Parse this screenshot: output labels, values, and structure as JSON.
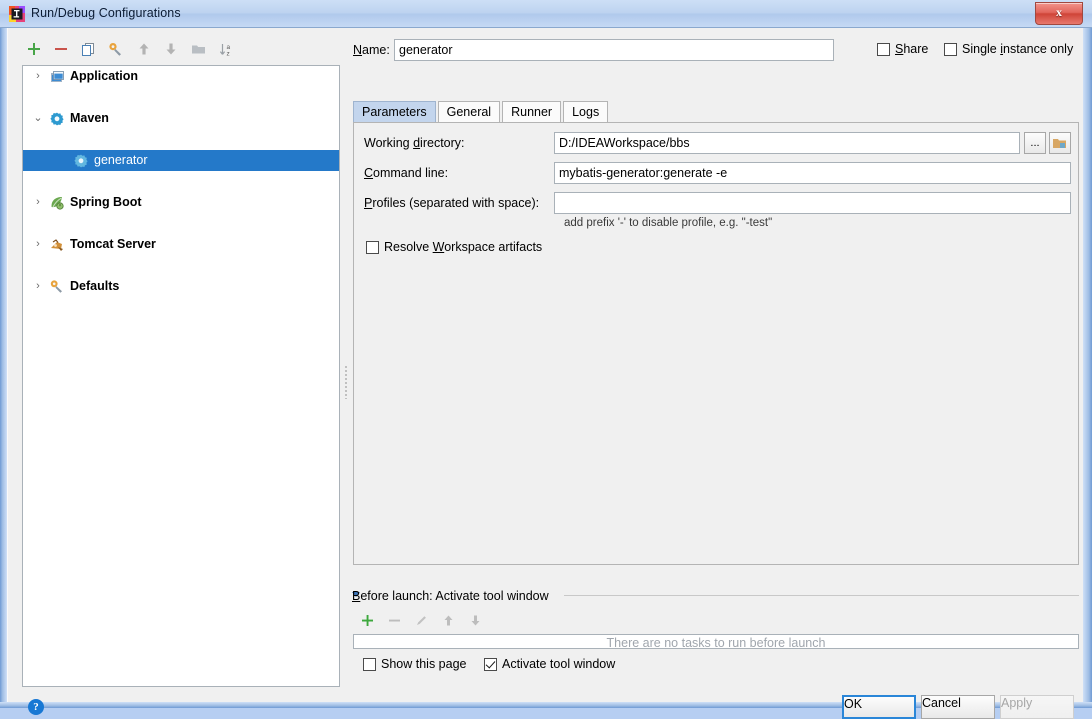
{
  "window": {
    "title": "Run/Debug Configurations",
    "app_icon": "intellij-idea-icon",
    "close_label": "x"
  },
  "toolbar": {
    "buttons": [
      {
        "name": "add-configuration-button",
        "icon": "plus-icon"
      },
      {
        "name": "remove-configuration-button",
        "icon": "minus-icon"
      },
      {
        "name": "copy-configuration-button",
        "icon": "copy-icon"
      },
      {
        "name": "edit-templates-button",
        "icon": "wrench-icon"
      },
      {
        "name": "move-up-button",
        "icon": "arrow-up-icon"
      },
      {
        "name": "move-down-button",
        "icon": "arrow-down-icon"
      },
      {
        "name": "create-folder-button",
        "icon": "folder-icon"
      },
      {
        "name": "sort-configurations-button",
        "icon": "sort-az-icon"
      }
    ]
  },
  "tree": {
    "nodes": [
      {
        "label": "Application",
        "icon": "application-icon",
        "arrow": "›",
        "expanded": false,
        "selected": false,
        "child": false
      },
      {
        "label": "Maven",
        "icon": "maven-icon",
        "arrow": "⌄",
        "expanded": true,
        "selected": false,
        "child": false
      },
      {
        "label": "generator",
        "icon": "maven-icon",
        "arrow": "",
        "expanded": false,
        "selected": true,
        "child": true
      },
      {
        "label": "Spring Boot",
        "icon": "spring-boot-icon",
        "arrow": "›",
        "expanded": false,
        "selected": false,
        "child": false
      },
      {
        "label": "Tomcat Server",
        "icon": "tomcat-icon",
        "arrow": "›",
        "expanded": false,
        "selected": false,
        "child": false
      },
      {
        "label": "Defaults",
        "icon": "defaults-icon",
        "arrow": "›",
        "expanded": false,
        "selected": false,
        "child": false
      }
    ]
  },
  "form": {
    "name_label": "Name:",
    "name_value": "generator",
    "share_label": "Share",
    "share_checked": false,
    "single_instance_label": "Single instance only",
    "single_instance_checked": false
  },
  "tabs": [
    {
      "label": "Parameters",
      "active": true
    },
    {
      "label": "General",
      "active": false
    },
    {
      "label": "Runner",
      "active": false
    },
    {
      "label": "Logs",
      "active": false
    }
  ],
  "parameters": {
    "working_directory_label": "Working directory:",
    "working_directory_value": "D:/IDEAWorkspace/bbs",
    "browse_button_label": "...",
    "module_browse_icon": "folder-module-icon",
    "command_line_label": "Command line:",
    "command_line_value": "mybatis-generator:generate -e",
    "profiles_label": "Profiles (separated with space):",
    "profiles_value": "",
    "profiles_hint": "add prefix '-' to disable profile, e.g. \"-test\"",
    "resolve_workspace_label": "Resolve Workspace artifacts",
    "resolve_workspace_checked": false
  },
  "before_launch": {
    "header": "Before launch: Activate tool window",
    "toolbar": [
      {
        "name": "add-task-button",
        "icon": "plus-icon",
        "enabled": true
      },
      {
        "name": "remove-task-button",
        "icon": "minus-icon",
        "enabled": false
      },
      {
        "name": "edit-task-button",
        "icon": "pencil-icon",
        "enabled": false
      },
      {
        "name": "task-move-up-button",
        "icon": "arrow-up-icon",
        "enabled": false
      },
      {
        "name": "task-move-down-button",
        "icon": "arrow-down-icon",
        "enabled": false
      }
    ],
    "empty_text": "There are no tasks to run before launch",
    "show_page_label": "Show this page",
    "show_page_checked": false,
    "activate_tool_window_label": "Activate tool window",
    "activate_tool_window_checked": true
  },
  "footer": {
    "help_label": "?",
    "ok_label": "OK",
    "cancel_label": "Cancel",
    "apply_label": "Apply",
    "apply_enabled": false
  },
  "colors": {
    "selection_blue": "#2479c9",
    "tab_active": "#c3d5ed",
    "accent_green": "#4caf50",
    "accent_red": "#d05a52",
    "focus_blue": "#2a86d8"
  }
}
